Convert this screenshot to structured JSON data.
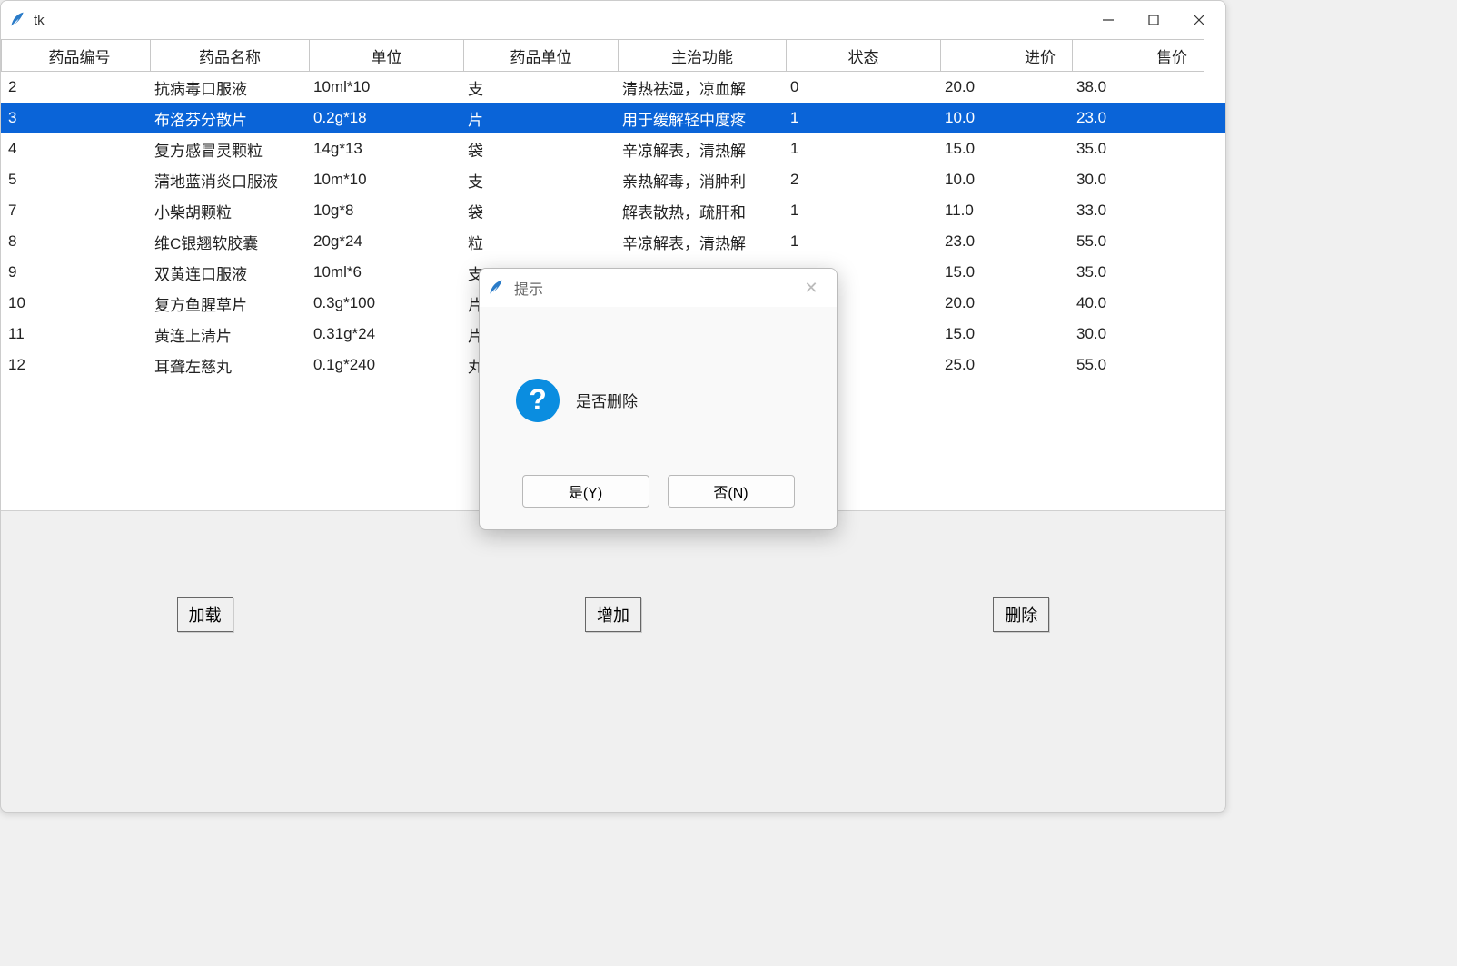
{
  "window": {
    "title": "tk"
  },
  "table": {
    "headers": [
      "药品编号",
      "药品名称",
      "单位",
      "药品单位",
      "主治功能",
      "状态",
      "进价",
      "售价"
    ],
    "selected_index": 1,
    "rows": [
      {
        "id": "2",
        "name": "抗病毒口服液",
        "spec": "10ml*10",
        "unit": "支",
        "func": "清热祛湿，凉血解",
        "status": "0",
        "cost": "20.0",
        "price": "38.0"
      },
      {
        "id": "3",
        "name": "布洛芬分散片",
        "spec": "0.2g*18",
        "unit": "片",
        "func": "用于缓解轻中度疼",
        "status": "1",
        "cost": "10.0",
        "price": "23.0"
      },
      {
        "id": "4",
        "name": "复方感冒灵颗粒",
        "spec": "14g*13",
        "unit": "袋",
        "func": "辛凉解表，清热解",
        "status": "1",
        "cost": "15.0",
        "price": "35.0"
      },
      {
        "id": "5",
        "name": "蒲地蓝消炎口服液",
        "spec": "10m*10",
        "unit": "支",
        "func": "亲热解毒，消肿利",
        "status": "2",
        "cost": "10.0",
        "price": "30.0"
      },
      {
        "id": "7",
        "name": "小柴胡颗粒",
        "spec": "10g*8",
        "unit": "袋",
        "func": "解表散热，疏肝和",
        "status": "1",
        "cost": "11.0",
        "price": "33.0"
      },
      {
        "id": "8",
        "name": "维C银翘软胶囊",
        "spec": "20g*24",
        "unit": "粒",
        "func": "辛凉解表，清热解",
        "status": "1",
        "cost": "23.0",
        "price": "55.0"
      },
      {
        "id": "9",
        "name": "双黄连口服液",
        "spec": "10ml*6",
        "unit": "支",
        "func": "",
        "status": "",
        "cost": "15.0",
        "price": "35.0"
      },
      {
        "id": "10",
        "name": "复方鱼腥草片",
        "spec": "0.3g*100",
        "unit": "片",
        "func": "",
        "status": "",
        "cost": "20.0",
        "price": "40.0"
      },
      {
        "id": "11",
        "name": "黄连上清片",
        "spec": "0.31g*24",
        "unit": "片",
        "func": "",
        "status": "",
        "cost": "15.0",
        "price": "30.0"
      },
      {
        "id": "12",
        "name": "耳聋左慈丸",
        "spec": "0.1g*240",
        "unit": "丸",
        "func": "",
        "status": "",
        "cost": "25.0",
        "price": "55.0"
      }
    ]
  },
  "buttons": {
    "load": "加载",
    "add": "增加",
    "delete": "删除"
  },
  "dialog": {
    "title": "提示",
    "message": "是否删除",
    "yes": "是(Y)",
    "no": "否(N)"
  }
}
